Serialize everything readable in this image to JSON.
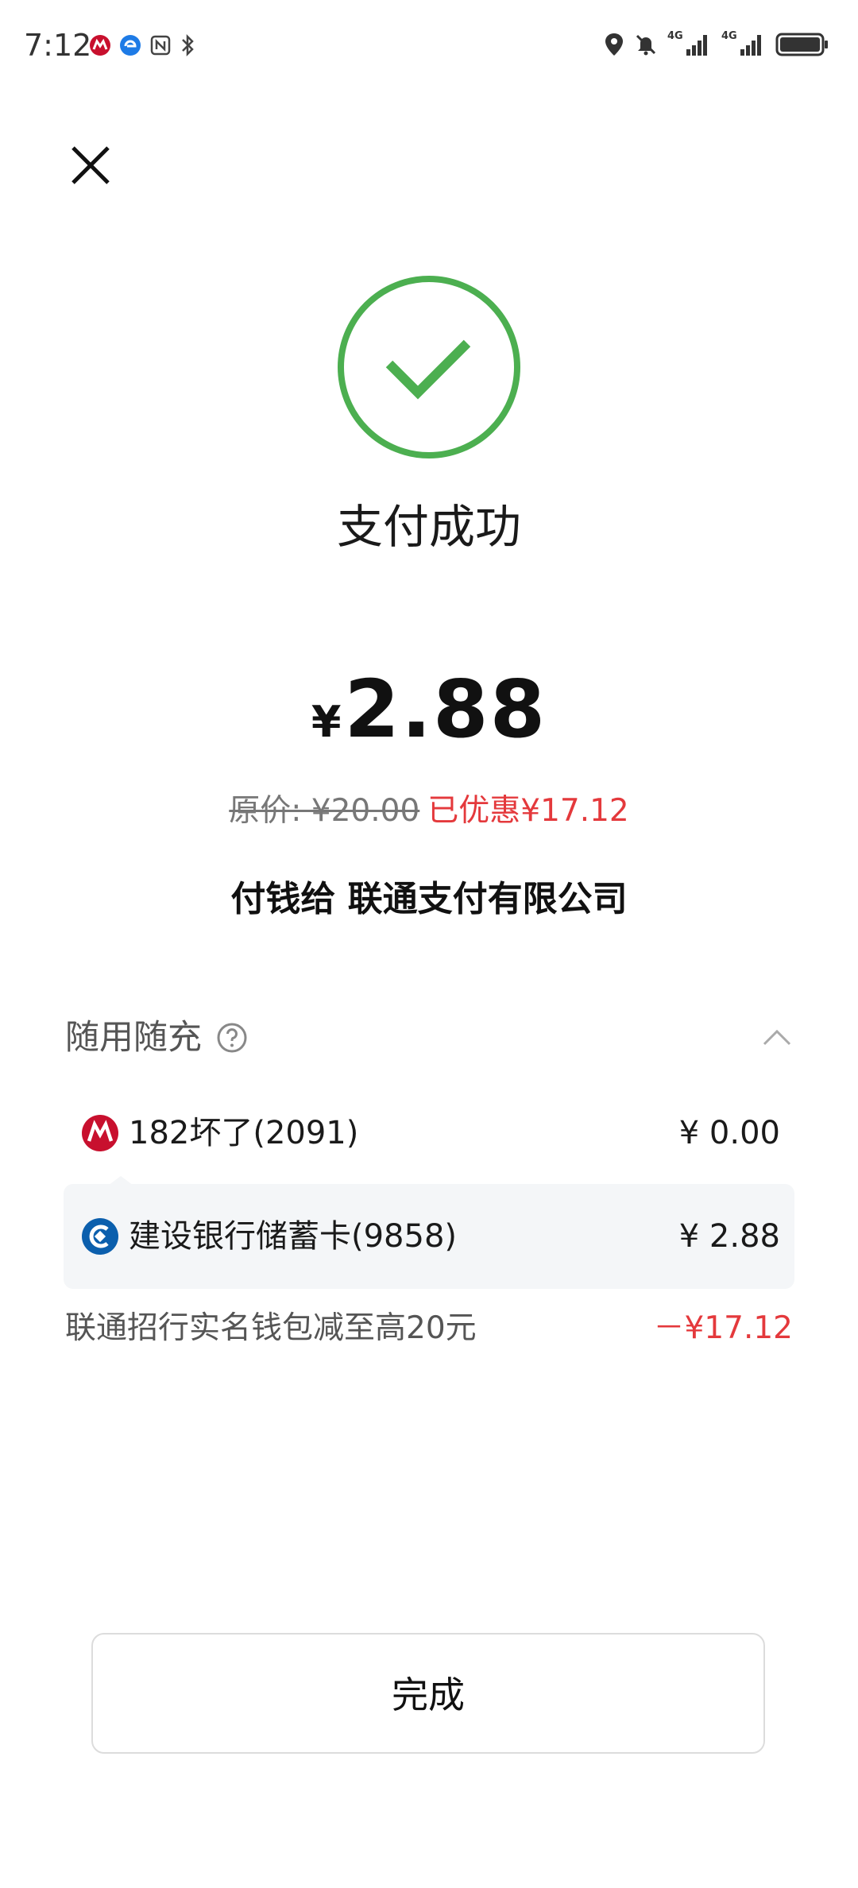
{
  "status_bar": {
    "time": "7:12",
    "left_icons": [
      "cmb-bank-icon",
      "browser-icon",
      "nfc-icon",
      "bluetooth-icon"
    ],
    "right_icons": [
      "location-icon",
      "mute-icon",
      "signal-4g-icon",
      "signal-4g-icon",
      "battery-icon"
    ],
    "network_labels": [
      "4G",
      "4G"
    ]
  },
  "header": {
    "close_icon": "close-icon"
  },
  "result": {
    "icon": "check-circle-icon",
    "title": "支付成功",
    "currency": "¥",
    "amount": "2.88",
    "original_price": "原价: ¥20.00",
    "discount_text": "已优惠¥17.12",
    "payee": "付钱给 联通支付有限公司"
  },
  "payment_section": {
    "title": "随用随充",
    "help_icon": "help-circle-icon",
    "collapse_icon": "chevron-up-icon",
    "methods": [
      {
        "icon": "cmb-bank-logo",
        "name": "182坏了(2091)",
        "amount": "¥ 0.00"
      },
      {
        "icon": "ccb-bank-logo",
        "name": "建设银行储蓄卡(9858)",
        "amount": "¥ 2.88"
      }
    ],
    "promo": {
      "label": "联通招行实名钱包减至高20元",
      "value": "－¥17.12"
    }
  },
  "footer": {
    "done_label": "完成"
  },
  "colors": {
    "success_green": "#4caf50",
    "discount_red": "#e4393c",
    "cmb_red": "#c8102e",
    "ccb_blue": "#0b5fad",
    "row_highlight": "#f4f6f8"
  }
}
